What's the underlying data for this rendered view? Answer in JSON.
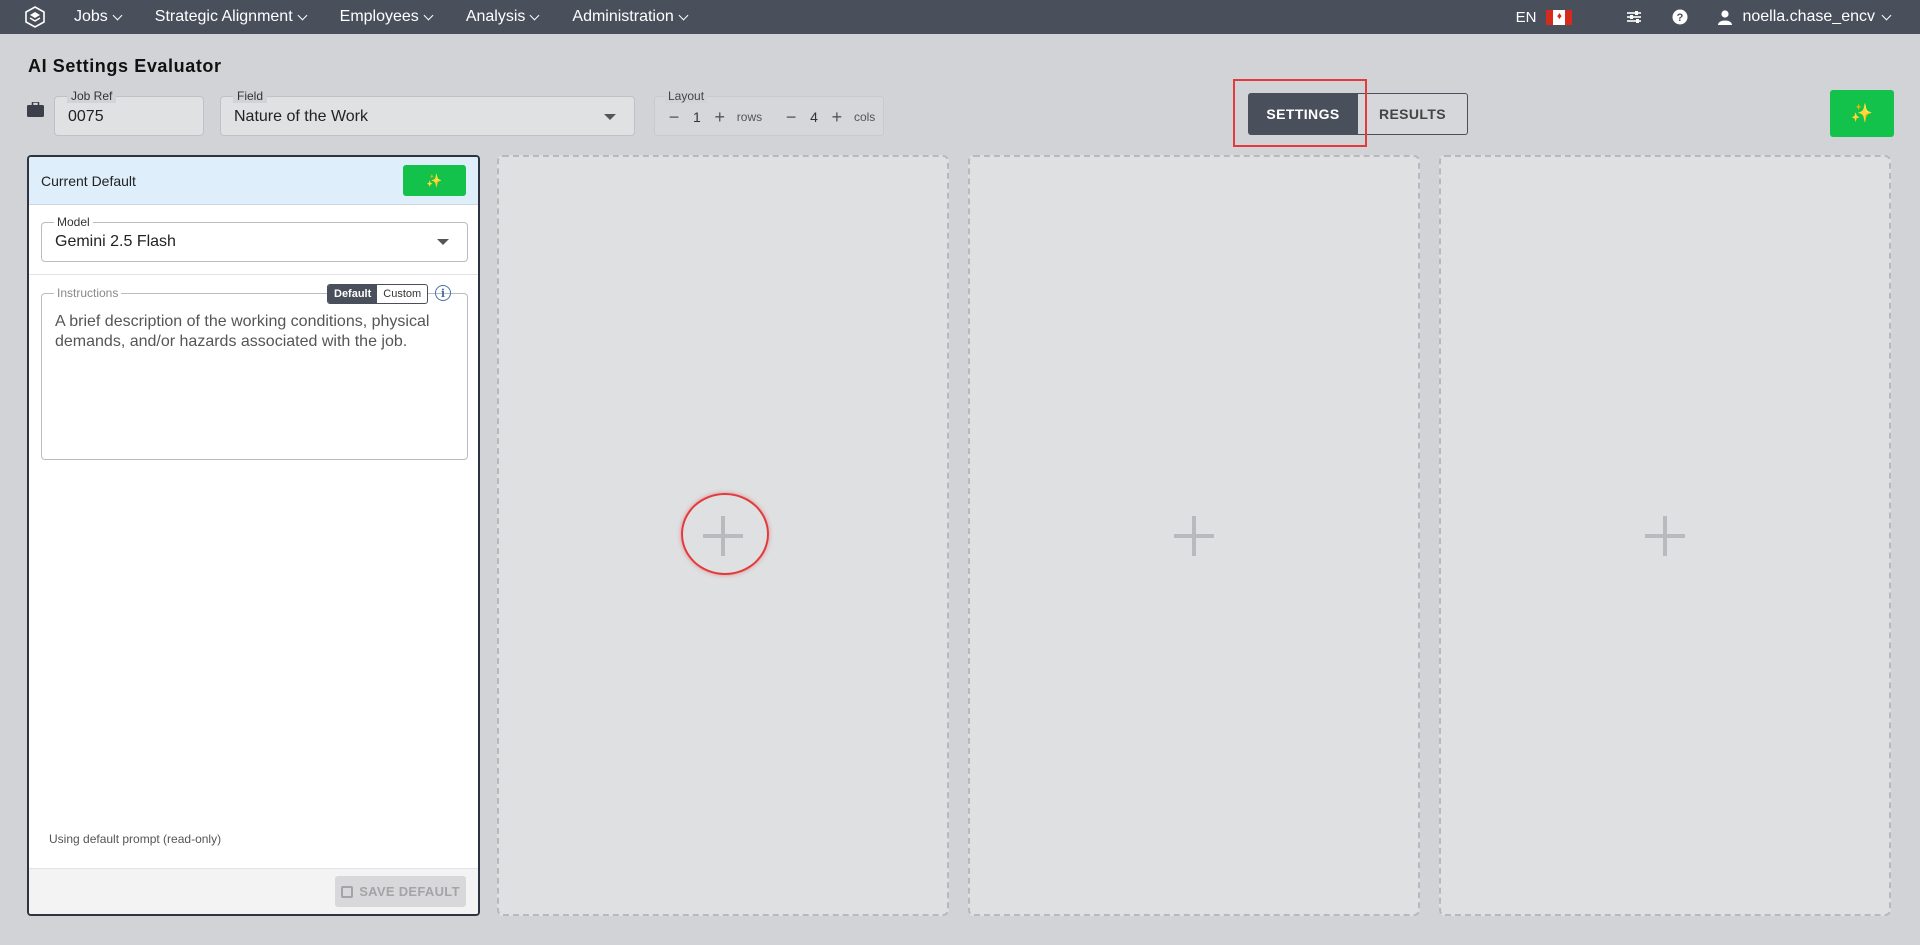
{
  "nav": {
    "items": [
      {
        "label": "Jobs"
      },
      {
        "label": "Strategic Alignment"
      },
      {
        "label": "Employees"
      },
      {
        "label": "Analysis"
      },
      {
        "label": "Administration"
      }
    ],
    "lang": "EN",
    "user": "noella.chase_encv"
  },
  "page": {
    "title": "AI Settings Evaluator"
  },
  "controls": {
    "job_ref_label": "Job Ref",
    "job_ref_value": "0075",
    "field_label": "Field",
    "field_value": "Nature of the Work",
    "layout_label": "Layout",
    "rows_value": "1",
    "rows_unit": "rows",
    "cols_value": "4",
    "cols_unit": "cols",
    "settings_label": "SETTINGS",
    "results_label": "RESULTS",
    "magic_glyph": "✨"
  },
  "panel": {
    "title": "Current Default",
    "magic_glyph": "✨",
    "model_label": "Model",
    "model_value": "Gemini 2.5 Flash",
    "instructions_label": "Instructions",
    "toggle_default": "Default",
    "toggle_custom": "Custom",
    "info_glyph": "i",
    "instructions_text": "A brief description of the working conditions, physical demands, and/or hazards associated with the job.",
    "note": "Using default prompt (read-only)",
    "save_label": "SAVE DEFAULT"
  },
  "colors": {
    "nav_bg": "#4a4f5c",
    "accent_green": "#12c24a",
    "highlight_red": "#e23b3b"
  }
}
